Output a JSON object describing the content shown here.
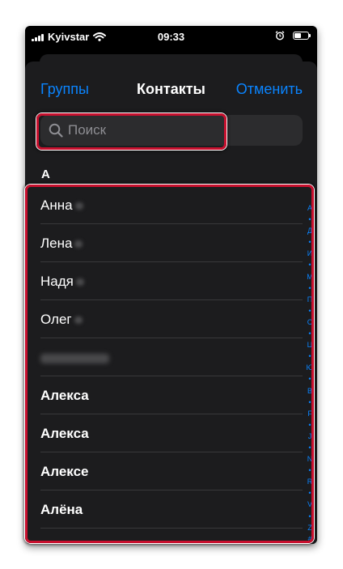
{
  "status_bar": {
    "carrier": "Kyivstar",
    "time": "09:33"
  },
  "nav": {
    "left_label": "Группы",
    "title": "Контакты",
    "right_label": "Отменить"
  },
  "search": {
    "placeholder": "Поиск"
  },
  "section": {
    "letter": "А"
  },
  "contacts": [
    {
      "name": "Анна",
      "bold": false
    },
    {
      "name": "Лена",
      "bold": false
    },
    {
      "name": "Надя",
      "bold": false
    },
    {
      "name": "Олег",
      "bold": false
    },
    {
      "name": "",
      "bold": false
    },
    {
      "name": "Алекса",
      "bold": true
    },
    {
      "name": "Алекса",
      "bold": true
    },
    {
      "name": "Алексе",
      "bold": true
    },
    {
      "name": "Алёна",
      "bold": true
    }
  ],
  "index": [
    "А",
    "•",
    "Д",
    "•",
    "И",
    "•",
    "М",
    "•",
    "П",
    "•",
    "С",
    "•",
    "Ц",
    "•",
    "Ю",
    "•",
    "В",
    "•",
    "F",
    "•",
    "J",
    "•",
    "N",
    "•",
    "R",
    "•",
    "V",
    "•",
    "Z",
    "#"
  ],
  "colors": {
    "accent": "#0a84ff",
    "highlight": "#c8102e",
    "background": "#1c1c1e"
  }
}
